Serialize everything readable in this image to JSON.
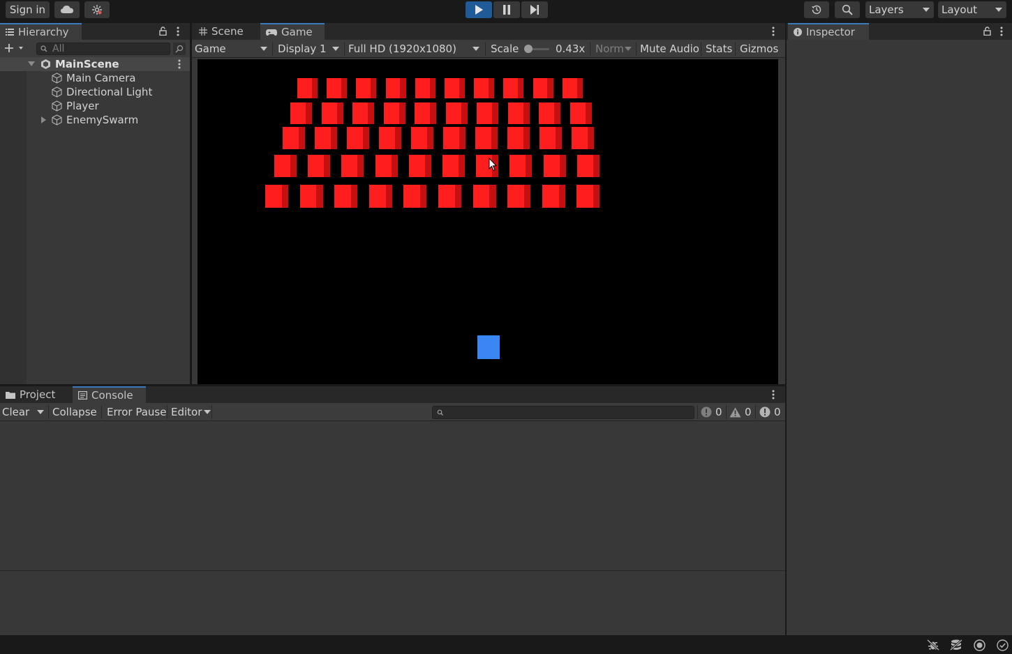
{
  "toolbar": {
    "sign_in": "Sign in",
    "cloud_icon": "cloud-icon",
    "collab_icon": "collab-icon",
    "play_icon": "play-icon",
    "pause_icon": "pause-icon",
    "step_icon": "step-icon",
    "history_icon": "history-icon",
    "search_icon": "search-icon",
    "layers": "Layers",
    "layout": "Layout",
    "play_active_color": "#1f5a99"
  },
  "hierarchy": {
    "tab": "Hierarchy",
    "search_placeholder": "All",
    "scene": "MainScene",
    "items": [
      {
        "label": "Main Camera"
      },
      {
        "label": "Directional Light"
      },
      {
        "label": "Player"
      },
      {
        "label": "EnemySwarm"
      }
    ]
  },
  "game": {
    "tabs": [
      "Scene",
      "Game"
    ],
    "mode": "Game",
    "display": "Display 1",
    "resolution": "Full HD (1920x1080)",
    "scale_label": "Scale",
    "scale_value": "0.43x",
    "norm": "Norm",
    "mute": "Mute Audio",
    "stats": "Stats",
    "gizmos": "Gizmos",
    "enemy_color": "#ff1e1e",
    "player_color": "#3a86f2",
    "enemy_rows": 5,
    "enemy_cols": 10
  },
  "inspector": {
    "tab": "Inspector"
  },
  "bottom": {
    "tabs": [
      "Project",
      "Console"
    ],
    "clear": "Clear",
    "collapse": "Collapse",
    "error_pause": "Error Pause",
    "editor": "Editor",
    "log_count": "0",
    "warn_count": "0",
    "error_count": "0"
  }
}
